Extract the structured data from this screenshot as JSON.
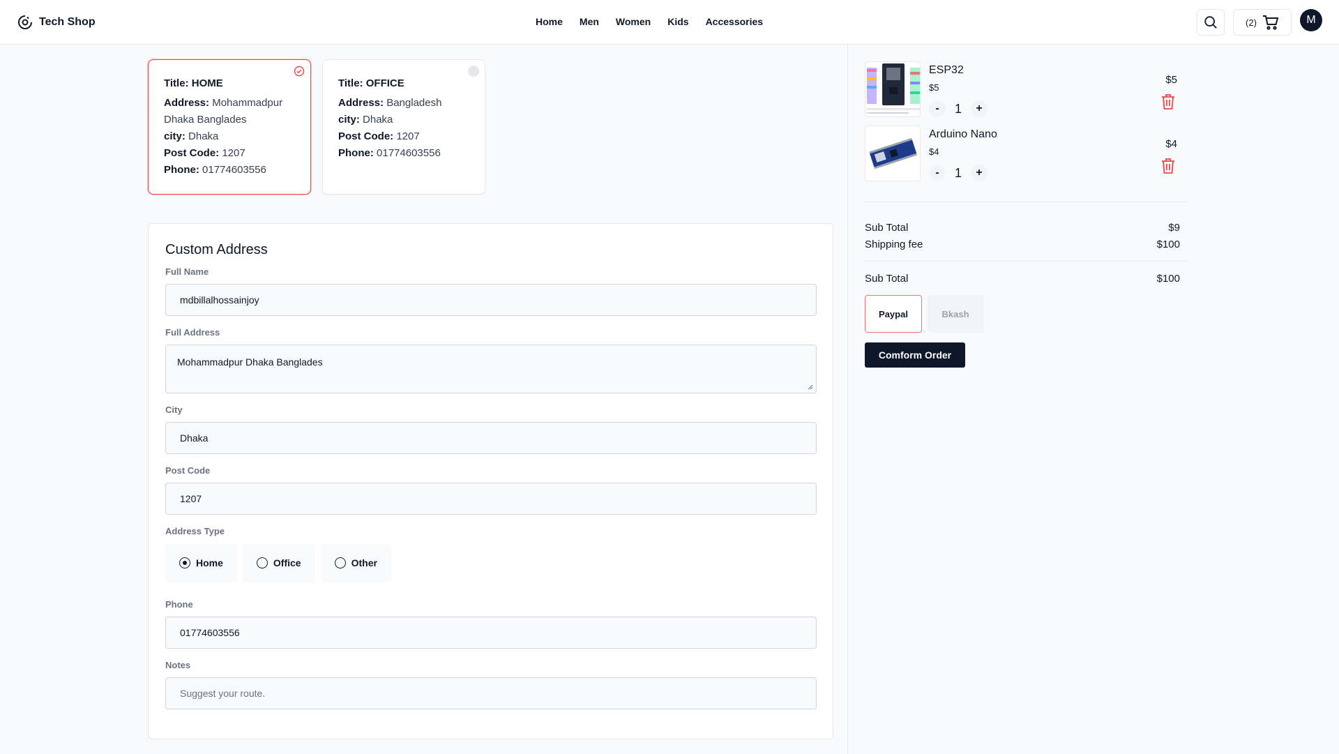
{
  "header": {
    "brand": "Tech Shop",
    "nav": [
      "Home",
      "Men",
      "Women",
      "Kids",
      "Accessories"
    ],
    "cart_count": "(2)",
    "avatar_initial": "M"
  },
  "saved_addresses": [
    {
      "title_label": "Title:",
      "title": "HOME",
      "address_label": "Address:",
      "address": "Mohammadpur Dhaka Banglades",
      "city_label": "city:",
      "city": "Dhaka",
      "post_label": "Post Code:",
      "post_code": "1207",
      "phone_label": "Phone:",
      "phone": "01774603556",
      "selected": true
    },
    {
      "title_label": "Title:",
      "title": "OFFICE",
      "address_label": "Address:",
      "address": "Bangladesh",
      "city_label": "city:",
      "city": "Dhaka",
      "post_label": "Post Code:",
      "post_code": "1207",
      "phone_label": "Phone:",
      "phone": "01774603556",
      "selected": false
    }
  ],
  "form": {
    "title": "Custom Address",
    "full_name_label": "Full Name",
    "full_name": "mdbillalhossainjoy",
    "full_address_label": "Full Address",
    "full_address": "Mohammadpur Dhaka Banglades",
    "city_label": "City",
    "city": "Dhaka",
    "post_code_label": "Post Code",
    "post_code": "1207",
    "address_type_label": "Address Type",
    "address_types": [
      "Home",
      "Office",
      "Other"
    ],
    "address_type_selected": "Home",
    "phone_label": "Phone",
    "phone": "01774603556",
    "notes_label": "Notes",
    "notes_placeholder": "Suggest your route."
  },
  "cart": {
    "items": [
      {
        "name": "ESP32",
        "unit_price": "$5",
        "qty": "1",
        "price": "$5",
        "minus": "-",
        "plus": "+"
      },
      {
        "name": "Arduino Nano",
        "unit_price": "$4",
        "qty": "1",
        "price": "$4",
        "minus": "-",
        "plus": "+"
      }
    ],
    "subtotal_label": "Sub Total",
    "subtotal": "$9",
    "shipping_label": "Shipping fee",
    "shipping": "$100",
    "total_label": "Sub Total",
    "total": "$100",
    "payment_methods": [
      "Paypal",
      "Bkash"
    ],
    "payment_selected": "Paypal",
    "confirm_label": "Comform Order"
  },
  "colors": {
    "accent_red": "#ef4444",
    "dark_navy": "#0f172a",
    "border": "#e5e7eb"
  }
}
